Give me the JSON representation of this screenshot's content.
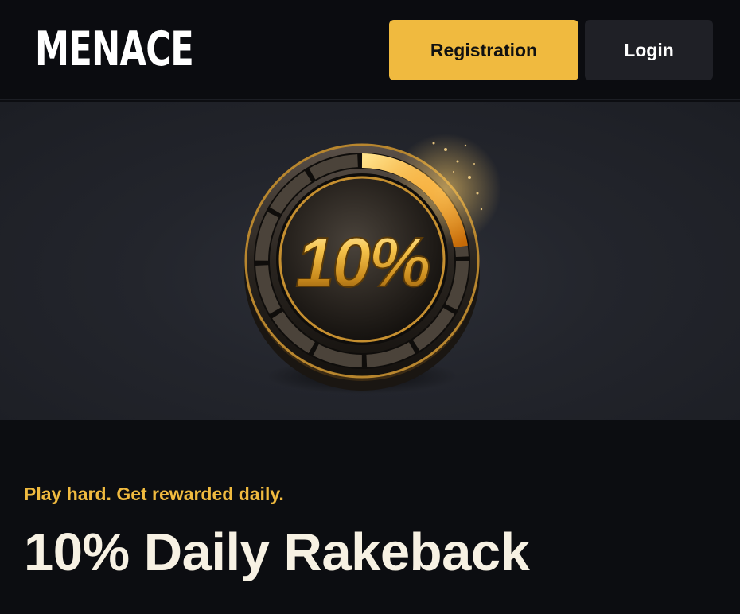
{
  "header": {
    "logo_text": "MENACE",
    "registration_label": "Registration",
    "login_label": "Login"
  },
  "hero": {
    "badge_text": "10%",
    "badge_icon": "rakeback-coin-icon"
  },
  "promo": {
    "tagline": "Play hard. Get rewarded daily.",
    "title": "10% Daily Rakeback"
  },
  "colors": {
    "accent": "#f0ba3f",
    "background": "#0c0d11",
    "login_button": "#1f2026",
    "title_text": "#f7f1e3"
  }
}
